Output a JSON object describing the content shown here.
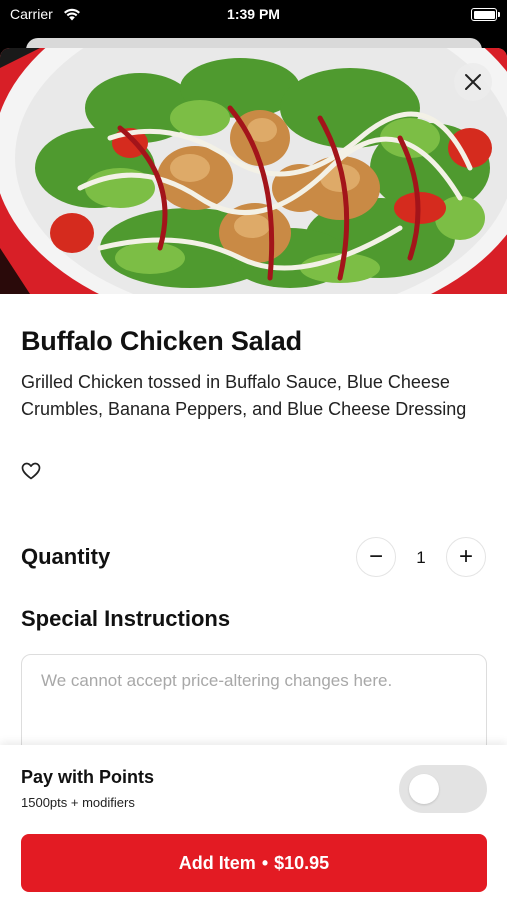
{
  "status_bar": {
    "carrier": "Carrier",
    "time": "1:39 PM",
    "wifi_icon": "wifi-icon",
    "battery_icon": "battery-icon"
  },
  "item": {
    "title": "Buffalo Chicken Salad",
    "description": "Grilled Chicken tossed in Buffalo Sauce, Blue Cheese Crumbles, Banana Peppers, and Blue Cheese Dressing",
    "image_description_icon": "salad-photo",
    "favorite_icon": "heart-outline-icon",
    "close_icon": "close-icon"
  },
  "quantity": {
    "label": "Quantity",
    "value": "1",
    "minus": "−",
    "plus": "+"
  },
  "special_instructions": {
    "label": "Special Instructions",
    "placeholder": "We cannot accept price-altering changes here.",
    "value": ""
  },
  "pay_with_points": {
    "label": "Pay with Points",
    "subtext": "1500pts + modifiers",
    "enabled": false
  },
  "add_button": {
    "label": "Add Item",
    "separator": "•",
    "price": "$10.95"
  },
  "colors": {
    "accent": "#e31b23",
    "toggle_off": "#e3e3e3"
  }
}
